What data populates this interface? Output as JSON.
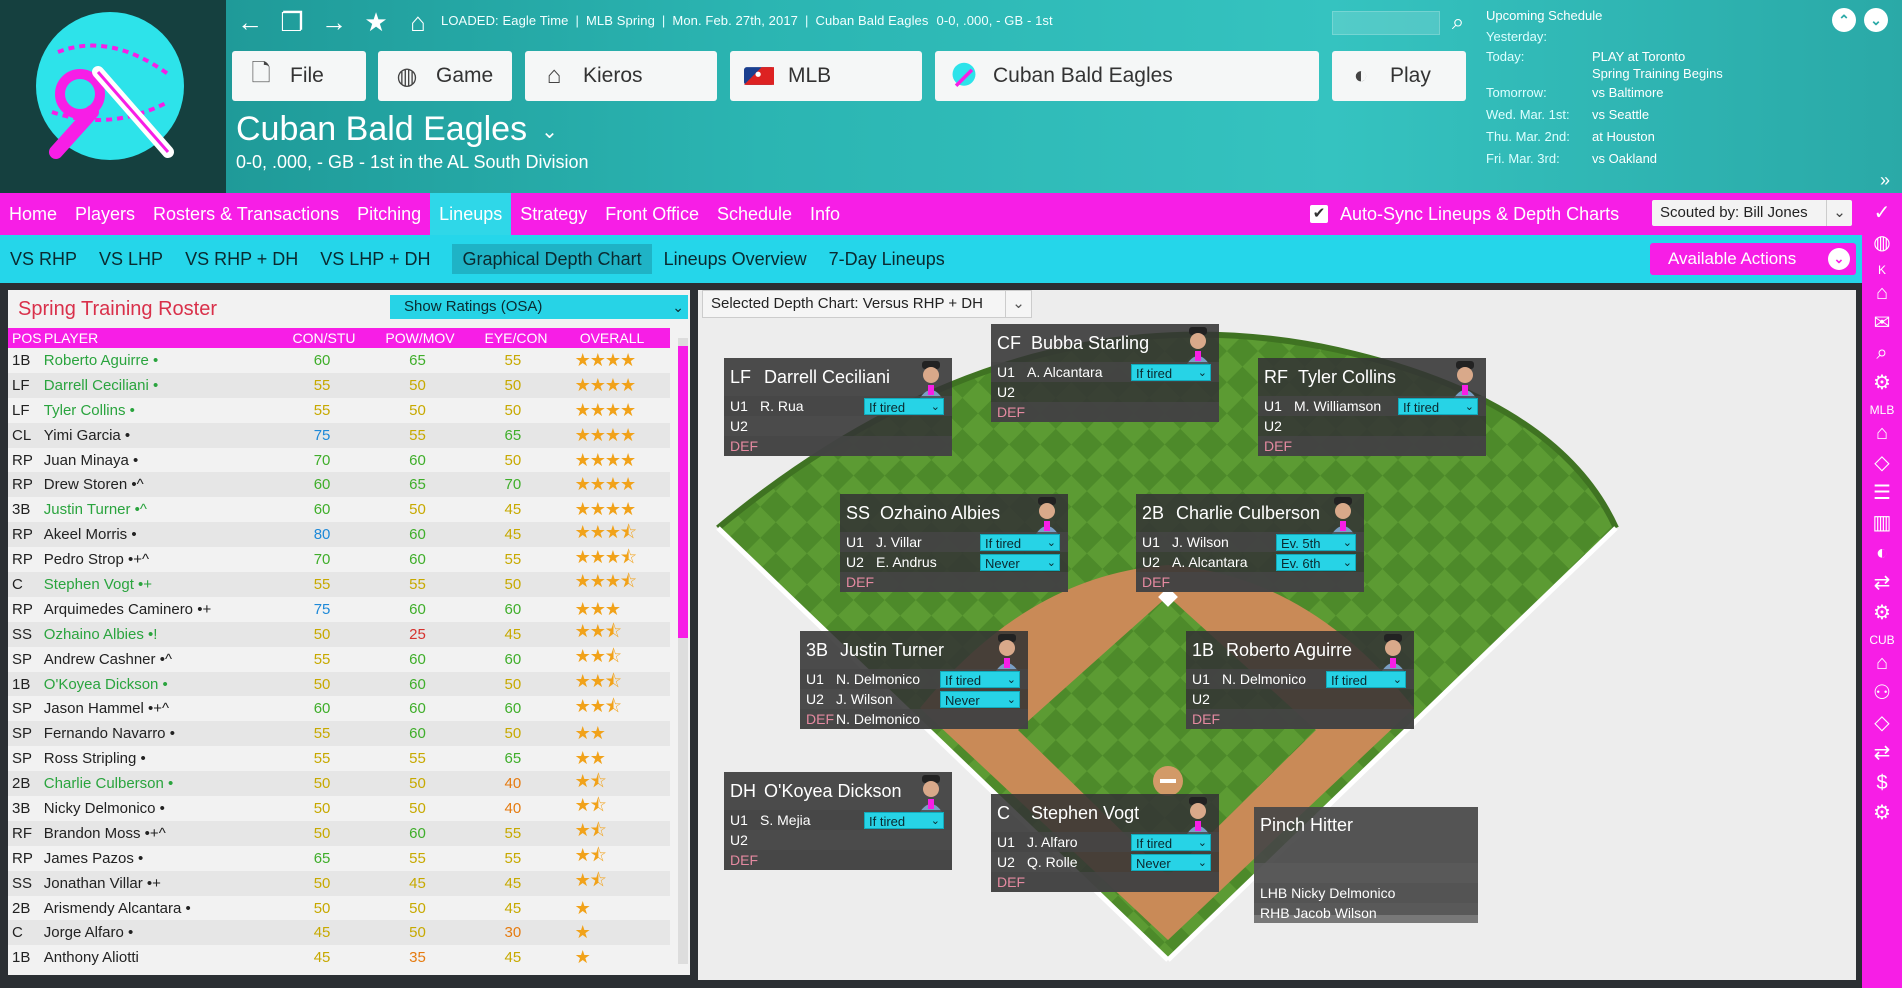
{
  "header": {
    "status": {
      "loaded": "LOADED: Eagle Time",
      "phase": "MLB Spring",
      "date": "Mon. Feb. 27th, 2017",
      "team": "Cuban Bald Eagles",
      "record": "0-0, .000, - GB - 1st"
    },
    "buttons": {
      "file": "File",
      "game": "Game",
      "kieros": "Kieros",
      "mlb": "MLB",
      "team": "Cuban Bald Eagles",
      "play": "Play"
    },
    "team_title": "Cuban Bald Eagles",
    "team_sub": "0-0, .000, - GB - 1st in the AL South Division",
    "schedule": {
      "title": "Upcoming Schedule",
      "items": [
        {
          "day": "Yesterday:",
          "event": ""
        },
        {
          "day": "Today:",
          "event": "PLAY at Toronto"
        },
        {
          "day": "",
          "event": "Spring Training Begins"
        },
        {
          "day": "Tomorrow:",
          "event": "vs Baltimore"
        },
        {
          "day": "Wed. Mar. 1st:",
          "event": "vs Seattle"
        },
        {
          "day": "Thu. Mar. 2nd:",
          "event": "at Houston"
        },
        {
          "day": "Fri. Mar. 3rd:",
          "event": "vs Oakland"
        }
      ]
    }
  },
  "main_nav": {
    "tabs": [
      "Home",
      "Players",
      "Rosters & Transactions",
      "Pitching",
      "Lineups",
      "Strategy",
      "Front Office",
      "Schedule",
      "Info"
    ],
    "active": "Lineups",
    "autosync_label": "Auto-Sync Lineups & Depth Charts",
    "scouted_by": "Scouted by: Bill Jones"
  },
  "sub_nav": {
    "tabs": [
      "VS RHP",
      "VS LHP",
      "VS RHP + DH",
      "VS LHP + DH",
      "Graphical Depth Chart",
      "Lineups Overview",
      "7-Day Lineups"
    ],
    "active": "Graphical Depth Chart",
    "available_actions": "Available Actions"
  },
  "rail": {
    "labels": [
      "K",
      "MLB",
      "CUB"
    ]
  },
  "roster": {
    "title": "Spring Training Roster",
    "ratings_select": "Show Ratings (OSA)",
    "columns": [
      "POS",
      "PLAYER",
      "CON/STU",
      "POW/MOV",
      "EYE/CON",
      "OVERALL"
    ],
    "rows": [
      {
        "pos": "1B",
        "name": "Roberto Aguirre •",
        "green": true,
        "r1": 60,
        "r2": 65,
        "r3": 55,
        "stars": 4
      },
      {
        "pos": "LF",
        "name": "Darrell Ceciliani •",
        "green": true,
        "r1": 55,
        "r2": 50,
        "r3": 50,
        "stars": 4
      },
      {
        "pos": "LF",
        "name": "Tyler Collins •",
        "green": true,
        "r1": 55,
        "r2": 50,
        "r3": 50,
        "stars": 4
      },
      {
        "pos": "CL",
        "name": "Yimi Garcia •",
        "green": false,
        "r1": 75,
        "r2": 55,
        "r3": 65,
        "stars": 4
      },
      {
        "pos": "RP",
        "name": "Juan Minaya •",
        "green": false,
        "r1": 70,
        "r2": 60,
        "r3": 50,
        "stars": 4
      },
      {
        "pos": "RP",
        "name": "Drew Storen •^",
        "green": false,
        "r1": 60,
        "r2": 65,
        "r3": 70,
        "stars": 4
      },
      {
        "pos": "3B",
        "name": "Justin Turner •^",
        "green": true,
        "r1": 60,
        "r2": 50,
        "r3": 45,
        "stars": 4
      },
      {
        "pos": "RP",
        "name": "Akeel Morris •",
        "green": false,
        "r1": 80,
        "r2": 60,
        "r3": 45,
        "stars": 3.5
      },
      {
        "pos": "RP",
        "name": "Pedro Strop •+^",
        "green": false,
        "r1": 70,
        "r2": 60,
        "r3": 55,
        "stars": 3.5
      },
      {
        "pos": "C",
        "name": "Stephen Vogt •+",
        "green": true,
        "r1": 55,
        "r2": 55,
        "r3": 50,
        "stars": 3.5
      },
      {
        "pos": "RP",
        "name": "Arquimedes Caminero •+",
        "green": false,
        "r1": 75,
        "r2": 60,
        "r3": 60,
        "stars": 3
      },
      {
        "pos": "SS",
        "name": "Ozhaino Albies •!",
        "green": true,
        "r1": 50,
        "r2": 25,
        "r3": 45,
        "stars": 2.5
      },
      {
        "pos": "SP",
        "name": "Andrew Cashner •^",
        "green": false,
        "r1": 55,
        "r2": 60,
        "r3": 60,
        "stars": 2.5
      },
      {
        "pos": "1B",
        "name": "O'Koyea Dickson •",
        "green": true,
        "r1": 50,
        "r2": 60,
        "r3": 50,
        "stars": 2.5
      },
      {
        "pos": "SP",
        "name": "Jason Hammel •+^",
        "green": false,
        "r1": 60,
        "r2": 60,
        "r3": 60,
        "stars": 2.5
      },
      {
        "pos": "SP",
        "name": "Fernando Navarro •",
        "green": false,
        "r1": 55,
        "r2": 60,
        "r3": 50,
        "stars": 2
      },
      {
        "pos": "SP",
        "name": "Ross Stripling •",
        "green": false,
        "r1": 55,
        "r2": 55,
        "r3": 65,
        "stars": 2
      },
      {
        "pos": "2B",
        "name": "Charlie Culberson •",
        "green": true,
        "r1": 50,
        "r2": 50,
        "r3": 40,
        "stars": 1.5
      },
      {
        "pos": "3B",
        "name": "Nicky Delmonico •",
        "green": false,
        "r1": 50,
        "r2": 50,
        "r3": 40,
        "stars": 1.5
      },
      {
        "pos": "RF",
        "name": "Brandon Moss •+^",
        "green": false,
        "r1": 50,
        "r2": 60,
        "r3": 55,
        "stars": 1.5
      },
      {
        "pos": "RP",
        "name": "James Pazos •",
        "green": false,
        "r1": 65,
        "r2": 55,
        "r3": 55,
        "stars": 1.5
      },
      {
        "pos": "SS",
        "name": "Jonathan Villar •+",
        "green": false,
        "r1": 50,
        "r2": 45,
        "r3": 45,
        "stars": 1.5
      },
      {
        "pos": "2B",
        "name": "Arismendy Alcantara •",
        "green": false,
        "r1": 50,
        "r2": 50,
        "r3": 45,
        "stars": 1
      },
      {
        "pos": "C",
        "name": "Jorge Alfaro •",
        "green": false,
        "r1": 45,
        "r2": 50,
        "r3": 30,
        "stars": 1
      },
      {
        "pos": "1B",
        "name": "Anthony Aliotti",
        "green": false,
        "r1": 45,
        "r2": 35,
        "r3": 45,
        "stars": 1
      }
    ]
  },
  "depth_chart": {
    "selected": "Selected Depth Chart: Versus RHP + DH",
    "positions": [
      {
        "id": "lf",
        "pos": "LF",
        "name": "Darrell Ceciliani",
        "u1": "R. Rua",
        "u1_chip": "If tired",
        "u2": "",
        "u2_chip": "",
        "def": ""
      },
      {
        "id": "cf",
        "pos": "CF",
        "name": "Bubba Starling",
        "u1": "A. Alcantara",
        "u1_chip": "If tired",
        "u2": "",
        "u2_chip": "",
        "def": ""
      },
      {
        "id": "rf",
        "pos": "RF",
        "name": "Tyler Collins",
        "u1": "M. Williamson",
        "u1_chip": "If tired",
        "u2": "",
        "u2_chip": "",
        "def": ""
      },
      {
        "id": "ss",
        "pos": "SS",
        "name": "Ozhaino Albies",
        "u1": "J. Villar",
        "u1_chip": "If tired",
        "u2": "E. Andrus",
        "u2_chip": "Never",
        "def": ""
      },
      {
        "id": "2b",
        "pos": "2B",
        "name": "Charlie Culberson",
        "u1": "J. Wilson",
        "u1_chip": "Ev. 5th",
        "u2": "A. Alcantara",
        "u2_chip": "Ev. 6th",
        "def": ""
      },
      {
        "id": "3b",
        "pos": "3B",
        "name": "Justin Turner",
        "u1": "N. Delmonico",
        "u1_chip": "If tired",
        "u2": "J. Wilson",
        "u2_chip": "Never",
        "def": "N. Delmonico"
      },
      {
        "id": "1b",
        "pos": "1B",
        "name": "Roberto Aguirre",
        "u1": "N. Delmonico",
        "u1_chip": "If tired",
        "u2": "",
        "u2_chip": "",
        "def": ""
      },
      {
        "id": "dh",
        "pos": "DH",
        "name": "O'Koyea Dickson",
        "u1": "S. Mejia",
        "u1_chip": "If tired",
        "u2": "",
        "u2_chip": "",
        "def": ""
      },
      {
        "id": "c",
        "pos": "C",
        "name": "Stephen Vogt",
        "u1": "J. Alfaro",
        "u1_chip": "If tired",
        "u2": "Q. Rolle",
        "u2_chip": "Never",
        "def": ""
      }
    ],
    "slot_labels": {
      "u1": "U1",
      "u2": "U2",
      "def": "DEF"
    },
    "pinch": {
      "title": "Pinch Hitter",
      "lhb": "LHB Nicky Delmonico",
      "rhb": "RHB Jacob Wilson"
    }
  },
  "colors": {
    "magenta": "#f71ee6",
    "cyan": "#25d6ea",
    "teal": "#2bb5b2"
  }
}
